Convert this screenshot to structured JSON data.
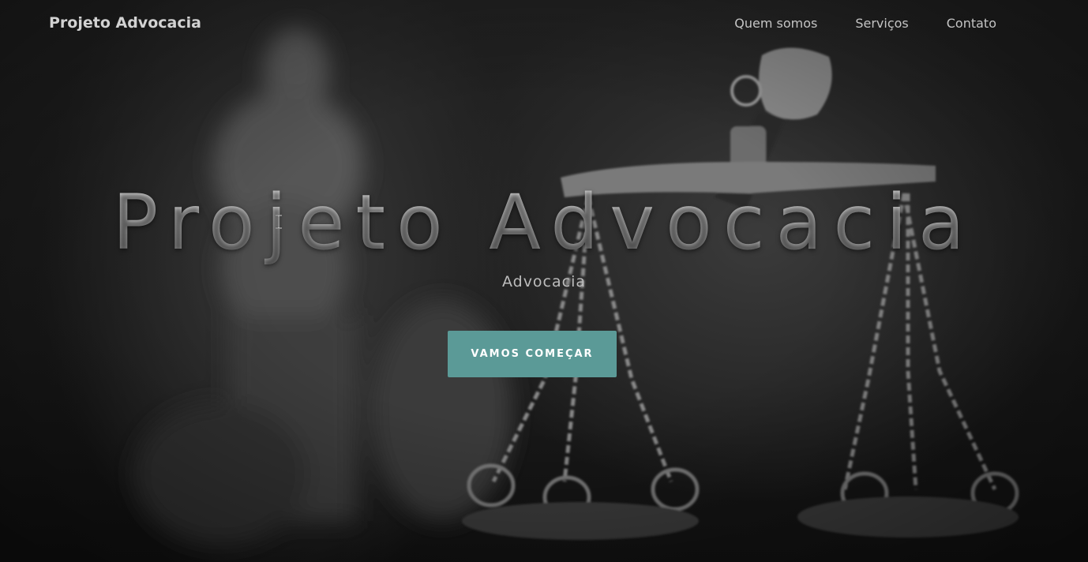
{
  "brand": {
    "title": "Projeto Advocacia"
  },
  "nav": {
    "items": [
      {
        "label": "Quem somos"
      },
      {
        "label": "Serviços"
      },
      {
        "label": "Contato"
      }
    ]
  },
  "hero": {
    "title": "Projeto Advocacia",
    "subtitle": "Advocacia",
    "cta_label": "VAMOS COMEÇAR"
  },
  "colors": {
    "accent": "#5b9a97",
    "background": "#1c1c1c",
    "text_light": "#c4c4c4"
  },
  "background_image": {
    "icon": "lady-justice-scales-photo"
  }
}
